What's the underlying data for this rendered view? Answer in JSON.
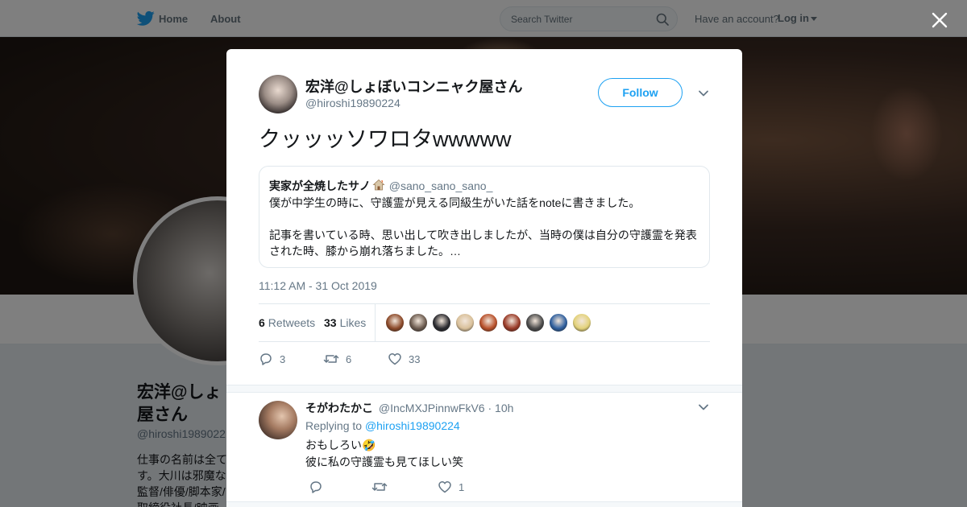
{
  "topbar": {
    "home_label": "Home",
    "about_label": "About",
    "search_placeholder": "Search Twitter",
    "have_account": "Have an account?",
    "login_label": "Log in"
  },
  "background_profile": {
    "name": "宏洋@しょぼいコンニャク屋さん",
    "name_visible": "宏洋@しょ\n屋さん",
    "handle": "@hiroshi1989022",
    "bio_visible": "仕事の名前は全て\nす。大川は邪魔な\n監督/俳優/脚本家/\n取締役社長/映画"
  },
  "tweet": {
    "author_name": "宏洋@しょぼいコンニャク屋さん",
    "author_handle": "@hiroshi19890224",
    "follow_label": "Follow",
    "text": "クッッッソワロタwwwww",
    "quote": {
      "name": "実家が全焼したサノ",
      "handle": "@sano_sano_sano_",
      "body": "僕が中学生の時に、守護霊が見える同級生がいた話をnoteに書きました。\n\n記事を書いている時、思い出して吹き出しましたが、当時の僕は自分の守護霊を発表された時、膝から崩れ落ちました。…"
    },
    "timestamp": "11:12 AM - 31 Oct 2019",
    "retweets_count": "6",
    "retweets_label": "Retweets",
    "likes_count": "33",
    "likes_label": "Likes",
    "liker_colors": [
      "#8c4a2a",
      "#6b5a4e",
      "#2b2b30",
      "#d9c09a",
      "#b8502a",
      "#9a3b28",
      "#4a4a4a",
      "#2f5f9e",
      "#e3d27a"
    ],
    "action_reply_count": "3",
    "action_retweet_count": "6",
    "action_like_count": "33"
  },
  "reply": {
    "name": "そがわたかこ",
    "handle": "@IncMXJPinnwFkV6",
    "dot": "·",
    "time": "10h",
    "replying_prefix": "Replying to",
    "replying_to": "@hiroshi19890224",
    "line1": "おもしろい🤣",
    "line2": "彼に私の守護霊も見てほしい笑",
    "like_count": "1"
  },
  "colors": {
    "brand_blue": "#1da1f2",
    "secondary_text": "#657786"
  }
}
